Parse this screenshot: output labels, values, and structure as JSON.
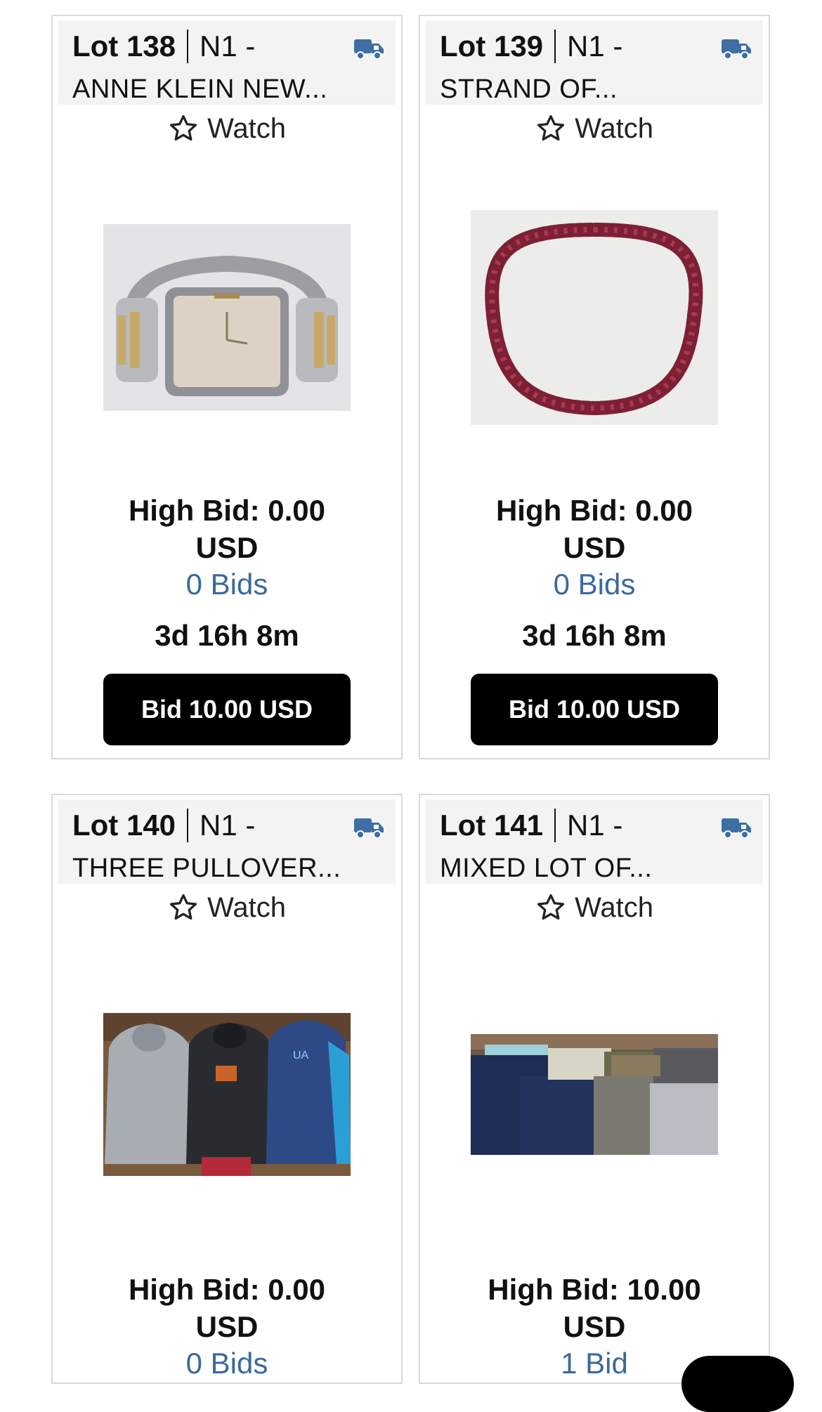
{
  "lots": [
    {
      "lot": "Lot 138",
      "code": "N1 -",
      "title": "ANNE KLEIN NEW...",
      "watch": "Watch",
      "high_bid": "High Bid: 0.00",
      "currency": "USD",
      "bids": "0 Bids",
      "time_left": "3d 16h 8m",
      "bid_button": "Bid 10.00 USD",
      "image": "watch"
    },
    {
      "lot": "Lot 139",
      "code": "N1 -",
      "title": "STRAND OF...",
      "watch": "Watch",
      "high_bid": "High Bid: 0.00",
      "currency": "USD",
      "bids": "0 Bids",
      "time_left": "3d 16h 8m",
      "bid_button": "Bid 10.00 USD",
      "image": "necklace"
    },
    {
      "lot": "Lot 140",
      "code": "N1 -",
      "title": "THREE PULLOVER...",
      "watch": "Watch",
      "high_bid": "High Bid: 0.00",
      "currency": "USD",
      "bids": "0 Bids",
      "image": "hoodies"
    },
    {
      "lot": "Lot 141",
      "code": "N1 -",
      "title": "MIXED LOT OF...",
      "watch": "Watch",
      "high_bid": "High Bid: 10.00",
      "currency": "USD",
      "bids": "1 Bid",
      "image": "shorts"
    }
  ],
  "colors": {
    "accent_blue": "#3a6a9a",
    "truck_icon": "#3d6fa4",
    "button_bg": "#000000",
    "header_bg": "#f3f3f3"
  },
  "icons": {
    "shipping": "truck-icon",
    "watch": "star-outline-icon"
  }
}
